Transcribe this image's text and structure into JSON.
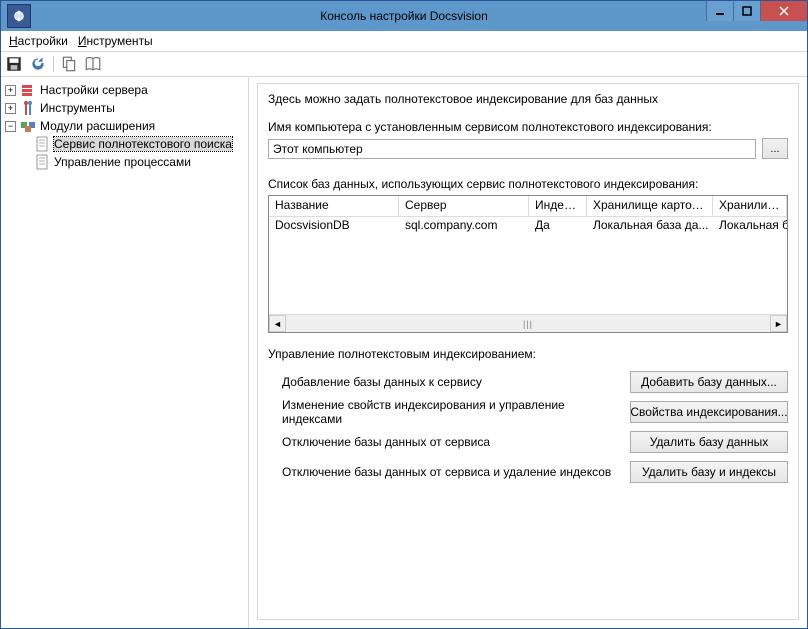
{
  "window": {
    "title": "Консоль настройки Docsvision"
  },
  "menu": {
    "settings": "Настройки",
    "tools": "Инструменты"
  },
  "tree": {
    "server_settings": "Настройки сервера",
    "tools": "Инструменты",
    "extensions": "Модули расширения",
    "fulltext_service": "Сервис полнотекстового поиска",
    "workflow": "Управление процессами"
  },
  "panel": {
    "desc": "Здесь можно задать полнотекстовое индексирование для баз данных",
    "host_label": "Имя компьютера с установленным сервисом полнотекстового индексирования:",
    "host_value": "Этот компьютер",
    "browse": "...",
    "list_label": "Список баз данных, использующих сервис полнотекстового индексирования:"
  },
  "grid": {
    "cols": {
      "name": "Название",
      "server": "Сервер",
      "index": "Индекс...",
      "card_store": "Хранилище карточек",
      "file_store": "Хранилище ф"
    },
    "row0": {
      "name": "DocsvisionDB",
      "server": "sql.company.com",
      "index": "Да",
      "card_store": "Локальная база да...",
      "file_store": "Локальная ба"
    }
  },
  "mgmt": {
    "group_label": "Управление полнотекстовым индексированием:",
    "row0_label": "Добавление базы данных к сервису",
    "row0_btn": "Добавить базу данных...",
    "row1_label": "Изменение свойств индексирования и управление индексами",
    "row1_btn": "Свойства индексирования...",
    "row2_label": "Отключение базы данных от сервиса",
    "row2_btn": "Удалить базу данных",
    "row3_label": "Отключение базы данных от сервиса и удаление индексов",
    "row3_btn": "Удалить базу и индексы"
  }
}
